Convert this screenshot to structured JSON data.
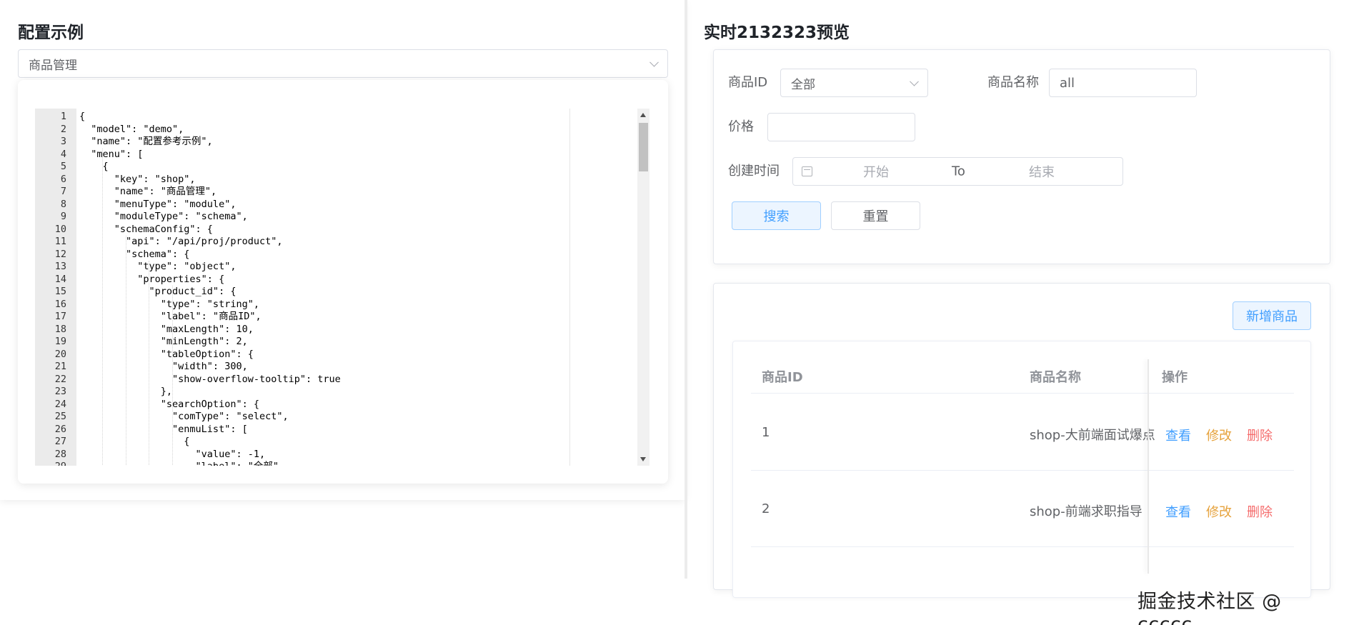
{
  "left": {
    "title": "配置示例",
    "select_value": "商品管理"
  },
  "editor": {
    "lines": [
      "{",
      "  \"model\": \"demo\",",
      "  \"name\": \"配置参考示例\",",
      "  \"menu\": [",
      "    {",
      "      \"key\": \"shop\",",
      "      \"name\": \"商品管理\",",
      "      \"menuType\": \"module\",",
      "      \"moduleType\": \"schema\",",
      "      \"schemaConfig\": {",
      "        \"api\": \"/api/proj/product\",",
      "        \"schema\": {",
      "          \"type\": \"object\",",
      "          \"properties\": {",
      "            \"product_id\": {",
      "              \"type\": \"string\",",
      "              \"label\": \"商品ID\",",
      "              \"maxLength\": 10,",
      "              \"minLength\": 2,",
      "              \"tableOption\": {",
      "                \"width\": 300,",
      "                \"show-overflow-tooltip\": true",
      "              },",
      "              \"searchOption\": {",
      "                \"comType\": \"select\",",
      "                \"enmuList\": [",
      "                  {",
      "                    \"value\": -1,",
      "                    \"label\": \"全部\","
    ],
    "line_numbers": [
      "1",
      "2",
      "3",
      "4",
      "5",
      "6",
      "7",
      "8",
      "9",
      "10",
      "11",
      "12",
      "13",
      "14",
      "15",
      "16",
      "17",
      "18",
      "19",
      "20",
      "21",
      "22",
      "23",
      "24",
      "25",
      "26",
      "27",
      "28",
      "29"
    ]
  },
  "right": {
    "title": "实时2132323预览",
    "search": {
      "product_id_label": "商品ID",
      "product_id_value": "全部",
      "product_name_label": "商品名称",
      "product_name_value": "all",
      "price_label": "价格",
      "price_value": "",
      "created_label": "创建时间",
      "start_placeholder": "开始",
      "range_separator": "To",
      "end_placeholder": "结束",
      "search_button": "搜索",
      "reset_button": "重置"
    },
    "table": {
      "add_button": "新增商品",
      "headers": [
        "商品ID",
        "商品名称",
        "操作"
      ],
      "rows": [
        {
          "id": "1",
          "name": "shop-大前端面试爆点"
        },
        {
          "id": "2",
          "name": "shop-前端求职指导"
        }
      ],
      "actions": {
        "view": "查看",
        "edit": "修改",
        "delete": "删除"
      }
    }
  },
  "colors": {
    "link_blue": "#409eff",
    "edit_orange": "#e6a23c",
    "delete_red": "#f56c6c"
  },
  "watermark": "掘金技术社区 @ ccccc__"
}
